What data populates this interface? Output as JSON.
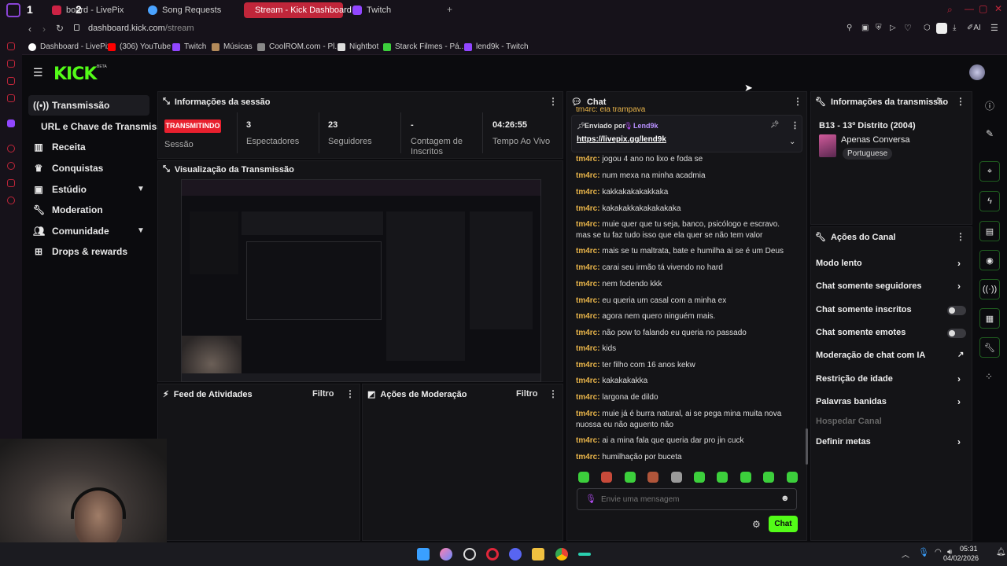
{
  "browser": {
    "tabs": [
      {
        "label": "board - LivePix",
        "icon": "livepix-icon",
        "color": "#cc2244"
      },
      {
        "label": "Song Requests",
        "icon": "globe-icon",
        "color": "#4aa3ff"
      },
      {
        "label": "Stream - Kick Dashboard",
        "icon": "kick-icon",
        "color": "#53fc18"
      },
      {
        "label": "Twitch",
        "icon": "twitch-icon",
        "color": "#9146ff"
      }
    ],
    "url_domain": "dashboard.kick.com",
    "url_path": "/stream",
    "bookmarks": [
      {
        "label": "Dashboard - LivePix",
        "color": "#ffffff"
      },
      {
        "label": "(306) YouTube",
        "color": "#ff0000"
      },
      {
        "label": "Twitch",
        "color": "#9146ff"
      },
      {
        "label": "Músicas",
        "color": "#b38a5a"
      },
      {
        "label": "CoolROM.com - Pl...",
        "color": "#888888"
      },
      {
        "label": "Nightbot",
        "color": "#dddddd"
      },
      {
        "label": "Starck Filmes - Pá...",
        "color": "#3ccf3c"
      },
      {
        "label": "lend9k - Twitch",
        "color": "#9146ff"
      }
    ]
  },
  "kick": {
    "logo": "KICK",
    "logo_badge": "BETA",
    "accent": "#53fc18",
    "nav": [
      {
        "label": "Transmissão",
        "icon": "broadcast-icon"
      },
      {
        "label": "URL e Chave de Transmissão",
        "icon": ""
      },
      {
        "label": "Receita",
        "icon": "chart-icon"
      },
      {
        "label": "Conquistas",
        "icon": "trophy-icon"
      },
      {
        "label": "Estúdio",
        "icon": "studio-icon"
      },
      {
        "label": "Moderation",
        "icon": "wrench-icon"
      },
      {
        "label": "Comunidade",
        "icon": "people-icon"
      },
      {
        "label": "Drops & rewards",
        "icon": "gift-icon"
      }
    ]
  },
  "session": {
    "title": "Informações da sessão",
    "status_badge": "TRANSMITINDO",
    "status_label": "Sessão",
    "stats": [
      {
        "value": "3",
        "label": "Espectadores"
      },
      {
        "value": "23",
        "label": "Seguidores"
      },
      {
        "value": "-",
        "label": "Contagem de Inscritos"
      },
      {
        "value": "04:26:55",
        "label": "Tempo Ao Vivo"
      }
    ]
  },
  "preview": {
    "title": "Visualização da Transmissão"
  },
  "activity": {
    "title": "Feed de Atividades",
    "filter": "Filtro"
  },
  "modactions": {
    "title": "Ações de Moderação",
    "filter": "Filtro"
  },
  "chat": {
    "title": "Chat",
    "partial_top": "tm4rc: ela trampava",
    "pinned_by_label": "Enviado por",
    "pinned_by_user": "Lend9k",
    "pinned_link": "https://livepix.gg/lend9k",
    "messages": [
      {
        "user": "tm4rc:",
        "text": "jogou 4 ano no lixo e foda se"
      },
      {
        "user": "tm4rc:",
        "text": "num mexa na minha acadmia"
      },
      {
        "user": "tm4rc:",
        "text": "kakkakakakakkaka"
      },
      {
        "user": "tm4rc:",
        "text": "kakakakkakakakakaka"
      },
      {
        "user": "tm4rc:",
        "text": "muie quer que tu seja, banco, psicólogo e escravo. mas se tu faz tudo isso que ela quer se não tem valor"
      },
      {
        "user": "tm4rc:",
        "text": "mais se tu maltrata, bate e humilha ai se é um Deus"
      },
      {
        "user": "tm4rc:",
        "text": "carai seu irmão tá vivendo no hard"
      },
      {
        "user": "tm4rc:",
        "text": "nem fodendo kkk"
      },
      {
        "user": "tm4rc:",
        "text": "eu queria um casal com a minha ex"
      },
      {
        "user": "tm4rc:",
        "text": "agora nem quero ninguém mais."
      },
      {
        "user": "tm4rc:",
        "text": "não pow to falando eu queria no passado"
      },
      {
        "user": "tm4rc:",
        "text": "kids"
      },
      {
        "user": "tm4rc:",
        "text": "ter filho com 16 anos kekw"
      },
      {
        "user": "tm4rc:",
        "text": "kakakakakka"
      },
      {
        "user": "tm4rc:",
        "text": "largona de dildo"
      },
      {
        "user": "tm4rc:",
        "text": "muie já é burra natural, ai se pega mina muita nova nuossa eu não aguento não"
      },
      {
        "user": "tm4rc:",
        "text": "ai a mina fala que queria dar pro jin cuck"
      },
      {
        "user": "tm4rc:",
        "text": "humilhação por buceta"
      }
    ],
    "input_placeholder": "Envie uma mensagem",
    "send_label": "Chat"
  },
  "stream_info": {
    "title": "Informações da transmissão",
    "stream_title": "B13 - 13º Distrito (2004)",
    "category": "Apenas Conversa",
    "language": "Portuguese"
  },
  "channel_actions": {
    "title": "Ações do Canal",
    "items": [
      {
        "label": "Modo lento",
        "control": "arrow"
      },
      {
        "label": "Chat somente seguidores",
        "control": "arrow"
      },
      {
        "label": "Chat somente inscritos",
        "control": "toggle-off"
      },
      {
        "label": "Chat somente emotes",
        "control": "toggle-off"
      },
      {
        "label": "Moderação de chat com IA",
        "control": "external"
      },
      {
        "label": "Restrição de idade",
        "control": "arrow"
      },
      {
        "label": "Palavras banidas",
        "control": "arrow"
      },
      {
        "label": "Hospedar Canal",
        "control": "disabled"
      },
      {
        "label": "Definir metas",
        "control": "arrow"
      }
    ]
  },
  "taskbar": {
    "time": "05:31",
    "date": "04/02/2026"
  }
}
